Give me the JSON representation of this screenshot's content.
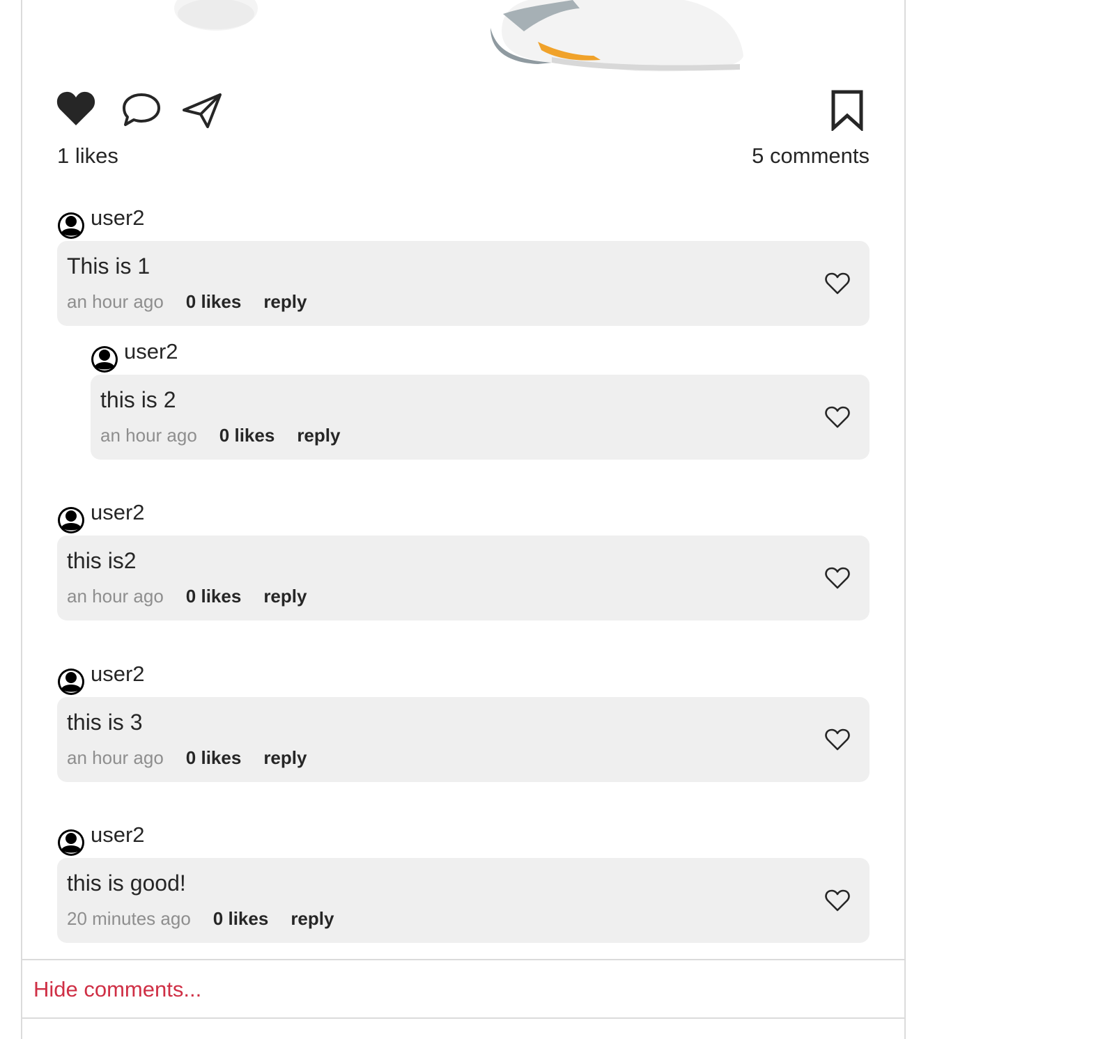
{
  "post": {
    "likes_label": "1 likes",
    "comments_label": "5 comments",
    "actions": {
      "like_icon": "heart-filled-icon",
      "comment_icon": "speech-bubble-icon",
      "share_icon": "paper-plane-icon",
      "save_icon": "bookmark-icon"
    }
  },
  "comments": [
    {
      "author": "user2",
      "text": "This is 1",
      "time": "an hour ago",
      "likes": "0 likes",
      "reply": "reply",
      "is_reply": false
    },
    {
      "author": "user2",
      "text": "this is 2",
      "time": "an hour ago",
      "likes": "0 likes",
      "reply": "reply",
      "is_reply": true
    },
    {
      "author": "user2",
      "text": "this is2",
      "time": "an hour ago",
      "likes": "0 likes",
      "reply": "reply",
      "is_reply": false
    },
    {
      "author": "user2",
      "text": "this is 3",
      "time": "an hour ago",
      "likes": "0 likes",
      "reply": "reply",
      "is_reply": false
    },
    {
      "author": "user2",
      "text": "this is good!",
      "time": "20 minutes ago",
      "likes": "0 likes",
      "reply": "reply",
      "is_reply": false
    }
  ],
  "footer": {
    "hide_comments_label": "Hide comments..."
  },
  "colors": {
    "bubble_bg": "#efefef",
    "hide_link": "#cf2f45",
    "border": "#dbdbdb"
  }
}
